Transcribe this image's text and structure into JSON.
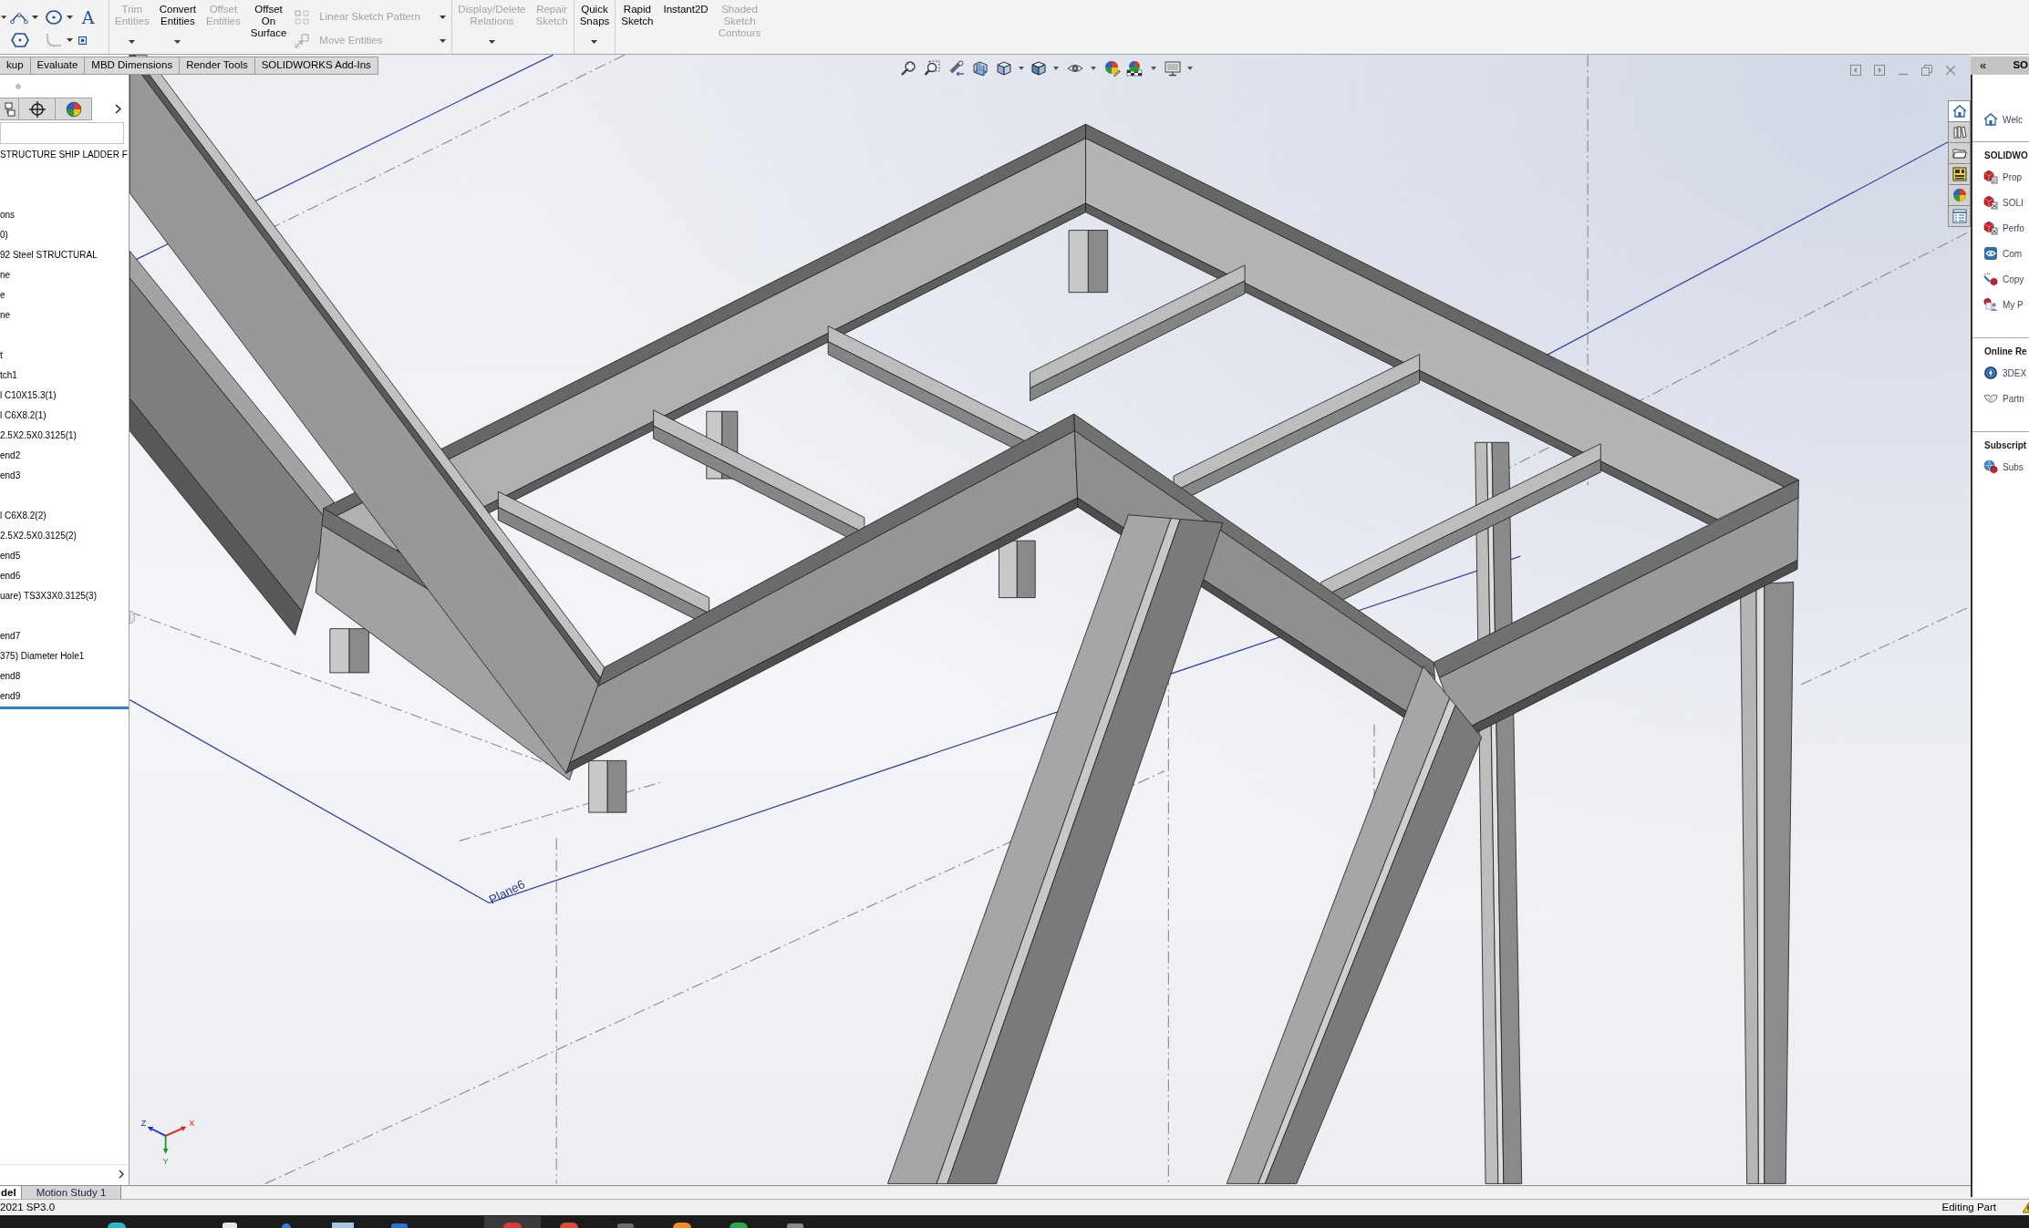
{
  "toolbar": {
    "sketch_tools": [
      {
        "kind": "icon",
        "disabled": false,
        "dropdown": true
      },
      {
        "kind": "icon",
        "disabled": false,
        "dropdown": true
      },
      {
        "kind": "glyph",
        "glyph": "A",
        "disabled": false,
        "dropdown": false
      },
      {
        "kind": "icon",
        "disabled": false,
        "dropdown": false
      },
      {
        "kind": "icon",
        "disabled": true,
        "dropdown": true
      },
      {
        "kind": "icon",
        "disabled": false,
        "dropdown": false
      }
    ],
    "groups": [
      {
        "buttons": [
          {
            "kind": "large",
            "label": "Trim Entities",
            "disabled": true,
            "dropdown": true
          },
          {
            "kind": "large",
            "label": "Convert Entities",
            "disabled": false,
            "dropdown": true
          },
          {
            "kind": "large",
            "label": "Offset Entities",
            "disabled": true,
            "dropdown": false
          },
          {
            "kind": "large",
            "label": "Offset On Surface",
            "disabled": false,
            "dropdown": false
          },
          {
            "kind": "stack",
            "items": [
              {
                "label": "Linear Sketch Pattern",
                "disabled": true,
                "dropdown": true
              },
              {
                "label": "Move Entities",
                "disabled": true,
                "dropdown": true
              }
            ]
          }
        ]
      },
      {
        "buttons": [
          {
            "kind": "large",
            "label": "Display/Delete Relations",
            "disabled": true,
            "dropdown": true
          },
          {
            "kind": "large",
            "label": "Repair Sketch",
            "disabled": true,
            "dropdown": false
          }
        ]
      },
      {
        "buttons": [
          {
            "kind": "large",
            "label": "Quick Snaps",
            "disabled": false,
            "dropdown": true
          }
        ]
      },
      {
        "buttons": [
          {
            "kind": "large",
            "label": "Rapid Sketch",
            "disabled": false,
            "dropdown": false
          },
          {
            "kind": "large",
            "label": "Instant2D",
            "disabled": false,
            "dropdown": false
          },
          {
            "kind": "large",
            "label": "Shaded Sketch Contours",
            "disabled": true,
            "dropdown": false
          }
        ]
      }
    ]
  },
  "tabs": [
    {
      "label": "kup",
      "selected": false
    },
    {
      "label": "Evaluate",
      "selected": false
    },
    {
      "label": "MBD Dimensions",
      "selected": false
    },
    {
      "label": "Render Tools",
      "selected": false
    },
    {
      "label": "SOLIDWORKS Add-Ins",
      "selected": false
    }
  ],
  "feature_tree": {
    "items": [
      {
        "kind": "item",
        "label": "STRUCTURE SHIP LADDER F"
      },
      {
        "kind": "clipped"
      },
      {
        "kind": "clipped"
      },
      {
        "kind": "item",
        "label": "ons"
      },
      {
        "kind": "item",
        "label": "0)"
      },
      {
        "kind": "item",
        "label": "92 Steel STRUCTURAL"
      },
      {
        "kind": "item",
        "label": "ne"
      },
      {
        "kind": "item",
        "label": "e"
      },
      {
        "kind": "item",
        "label": "ne"
      },
      {
        "kind": "clipped"
      },
      {
        "kind": "item",
        "label": "t"
      },
      {
        "kind": "item",
        "label": "tch1"
      },
      {
        "kind": "item",
        "label": "l C10X15.3(1)"
      },
      {
        "kind": "item",
        "label": "l C6X8.2(1)"
      },
      {
        "kind": "item",
        "label": "2.5X2.5X0.3125(1)"
      },
      {
        "kind": "item",
        "label": "end2"
      },
      {
        "kind": "item",
        "label": "end3"
      },
      {
        "kind": "clipped"
      },
      {
        "kind": "item",
        "label": "l C6X8.2(2)"
      },
      {
        "kind": "item",
        "label": "2.5X2.5X0.3125(2)"
      },
      {
        "kind": "item",
        "label": "end5"
      },
      {
        "kind": "item",
        "label": "end6"
      },
      {
        "kind": "item",
        "label": "uare) TS3X3X0.3125(3)"
      },
      {
        "kind": "clipped"
      },
      {
        "kind": "item",
        "label": "end7"
      },
      {
        "kind": "item",
        "label": "375) Diameter Hole1"
      },
      {
        "kind": "item",
        "label": "end8"
      },
      {
        "kind": "item",
        "label": "end9"
      }
    ]
  },
  "viewport": {
    "plane_label": "Plane6",
    "triad": [
      {
        "label": "X",
        "color": "#e0201c"
      },
      {
        "label": "Y",
        "color": "#1b9a2a"
      },
      {
        "label": "Z",
        "color": "#1f2fbf"
      }
    ]
  },
  "task_pane": {
    "collapse_glyph": "«",
    "title": "SO",
    "tabs": [
      {
        "selected": true
      },
      {
        "selected": false
      },
      {
        "selected": false
      },
      {
        "selected": false
      },
      {
        "selected": false
      },
      {
        "selected": false
      }
    ],
    "groups": [
      {
        "items": [
          {
            "label": "Welc"
          }
        ]
      },
      {
        "heading": "SOLIDWO",
        "items": [
          {
            "label": "Prop"
          },
          {
            "label": "SOLI"
          },
          {
            "label": "Perfo"
          },
          {
            "label": "Com"
          },
          {
            "label": "Copy"
          },
          {
            "label": "My P"
          }
        ]
      },
      {
        "heading": "Online Re",
        "items": [
          {
            "label": "3DEX"
          },
          {
            "label": "Partn"
          }
        ]
      },
      {
        "heading": "Subscript",
        "items": [
          {
            "label": "Subs"
          }
        ]
      }
    ]
  },
  "model_tabs": [
    {
      "label": "del",
      "selected": true
    },
    {
      "label": "Motion Study 1",
      "selected": false
    }
  ],
  "status_bar": {
    "version": "2021 SP3.0",
    "mode": "Editing Part"
  },
  "taskbar": {
    "apps": [
      {
        "selected": false
      },
      {
        "selected": false
      },
      {
        "selected": false
      },
      {
        "selected": false
      },
      {
        "selected": false
      },
      {
        "selected": true
      },
      {
        "selected": false
      },
      {
        "selected": false
      },
      {
        "selected": false
      },
      {
        "selected": false
      },
      {
        "selected": false
      }
    ]
  }
}
